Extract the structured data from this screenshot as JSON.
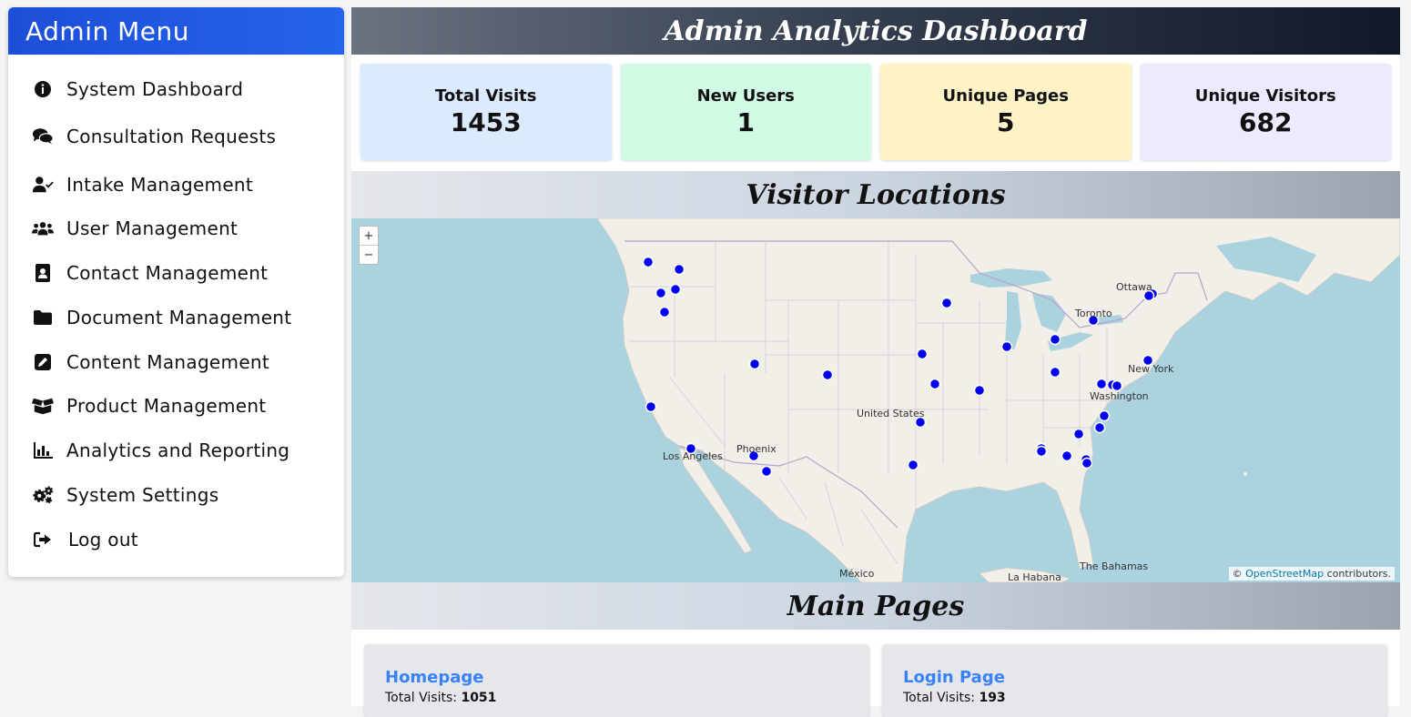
{
  "sidebar": {
    "title": "Admin Menu",
    "items": [
      {
        "label": "System Dashboard",
        "icon": "info-circle-icon"
      },
      {
        "label": "Consultation Requests",
        "icon": "comments-icon"
      },
      {
        "label": "Intake Management",
        "icon": "user-check-icon"
      },
      {
        "label": "User Management",
        "icon": "users-icon"
      },
      {
        "label": "Contact Management",
        "icon": "address-book-icon"
      },
      {
        "label": "Document Management",
        "icon": "folder-icon"
      },
      {
        "label": "Content Management",
        "icon": "edit-icon"
      },
      {
        "label": "Product Management",
        "icon": "box-open-icon"
      },
      {
        "label": "Analytics and Reporting",
        "icon": "chart-bar-icon"
      },
      {
        "label": "System Settings",
        "icon": "cogs-icon"
      },
      {
        "label": "Log out",
        "icon": "sign-out-icon"
      }
    ]
  },
  "header": {
    "title": "Admin Analytics Dashboard"
  },
  "stats": [
    {
      "label": "Total Visits",
      "value": "1453",
      "color": "#dbeafe"
    },
    {
      "label": "New Users",
      "value": "1",
      "color": "#d1fae5"
    },
    {
      "label": "Unique Pages",
      "value": "5",
      "color": "#fef3c7"
    },
    {
      "label": "Unique Visitors",
      "value": "682",
      "color": "#ede9fe"
    }
  ],
  "map_section": {
    "title": "Visitor Locations",
    "zoom_in": "+",
    "zoom_out": "−",
    "attribution_prefix": "©",
    "attribution_link": "OpenStreetMap",
    "attribution_suffix": "contributors.",
    "cities": [
      "Ottawa",
      "Toronto",
      "New York",
      "Washington",
      "United States",
      "Los Angeles",
      "Phoenix",
      "México",
      "La Habana",
      "The Bahamas"
    ],
    "marker_color": "#0000ee"
  },
  "pages_section": {
    "title": "Main Pages",
    "visits_label": "Total Visits:",
    "pages": [
      {
        "name": "Homepage",
        "visits": "1051"
      },
      {
        "name": "Login Page",
        "visits": "193"
      }
    ]
  }
}
